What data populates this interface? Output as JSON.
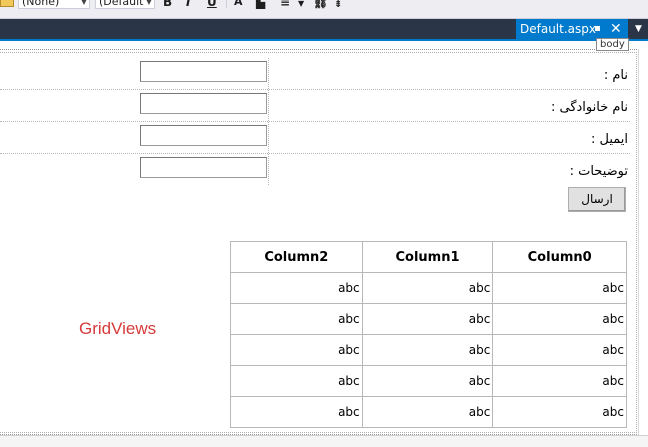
{
  "toolbar": {
    "style_select": "(None)",
    "font_select": "(Default",
    "bold_label": "B",
    "italic_label": "I",
    "underline_label": "U"
  },
  "tabs": {
    "active_label": "Default.aspx",
    "pin_glyph": "▪",
    "close_glyph": "✕",
    "menu_glyph": "▼"
  },
  "surface": {
    "body_tag": "body",
    "accent_color": "#007acc"
  },
  "form": {
    "rows": [
      {
        "label": "نام :",
        "value": ""
      },
      {
        "label": "نام خانوادگی :",
        "value": ""
      },
      {
        "label": "ایمیل :",
        "value": ""
      },
      {
        "label": "توضیحات :",
        "value": ""
      }
    ],
    "submit_label": "ارسال"
  },
  "gridviews_label": "GridViews",
  "grid": {
    "headers": [
      "Column2",
      "Column1",
      "Column0"
    ],
    "rows": [
      [
        "abc",
        "abc",
        "abc"
      ],
      [
        "abc",
        "abc",
        "abc"
      ],
      [
        "abc",
        "abc",
        "abc"
      ],
      [
        "abc",
        "abc",
        "abc"
      ],
      [
        "abc",
        "abc",
        "abc"
      ]
    ]
  }
}
